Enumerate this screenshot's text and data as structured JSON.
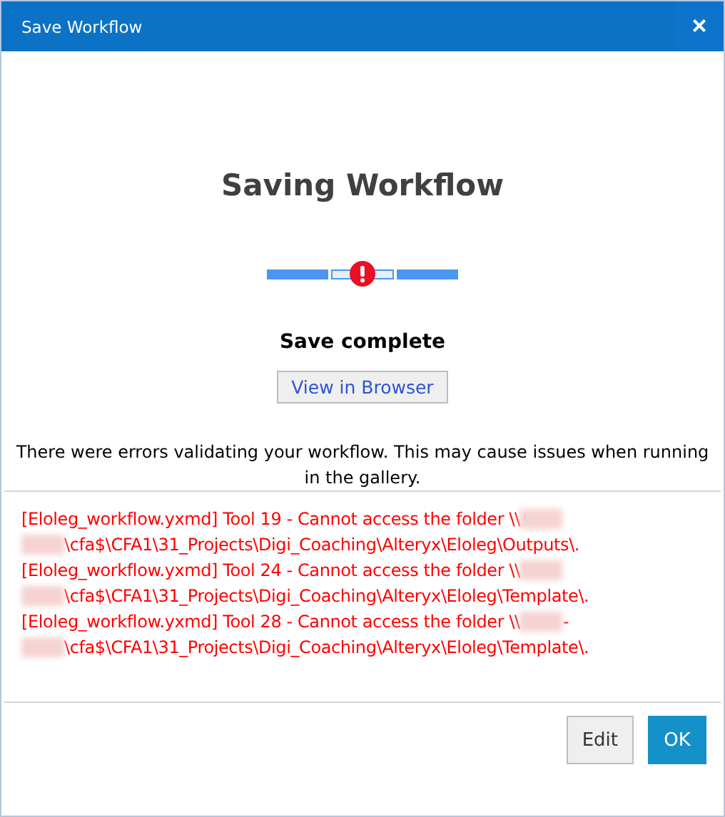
{
  "window": {
    "title": "Save Workflow",
    "close": "×"
  },
  "heading": "Saving Workflow",
  "progress": {
    "error": true
  },
  "status": "Save complete",
  "view_button": "View in Browser",
  "message": "There were errors validating your workflow. This may cause issues when running in the gallery.",
  "errors": [
    {
      "parts": [
        {
          "kind": "text",
          "text": "[Eloleg_workflow.yxmd] Tool 19 - Cannot access the folder \\\\"
        },
        {
          "kind": "redacted"
        },
        {
          "kind": "break"
        },
        {
          "kind": "redacted"
        },
        {
          "kind": "text",
          "text": "\\cfa$\\CFA1\\31_Projects\\Digi_Coaching\\Alteryx\\Eloleg\\Outputs\\."
        }
      ]
    },
    {
      "parts": [
        {
          "kind": "text",
          "text": "[Eloleg_workflow.yxmd] Tool 24 - Cannot access the folder \\\\"
        },
        {
          "kind": "redacted"
        },
        {
          "kind": "break"
        },
        {
          "kind": "redacted"
        },
        {
          "kind": "text",
          "text": "\\cfa$\\CFA1\\31_Projects\\Digi_Coaching\\Alteryx\\Eloleg\\Template\\."
        }
      ]
    },
    {
      "parts": [
        {
          "kind": "text",
          "text": "[Eloleg_workflow.yxmd] Tool 28 - Cannot access the folder \\\\"
        },
        {
          "kind": "redacted"
        },
        {
          "kind": "text",
          "text": "-"
        },
        {
          "kind": "break"
        },
        {
          "kind": "redacted"
        },
        {
          "kind": "text",
          "text": "\\cfa$\\CFA1\\31_Projects\\Digi_Coaching\\Alteryx\\Eloleg\\Template\\."
        }
      ]
    }
  ],
  "buttons": [
    {
      "label": "Edit",
      "kind": "secondary"
    },
    {
      "label": "OK",
      "kind": "primary"
    }
  ]
}
